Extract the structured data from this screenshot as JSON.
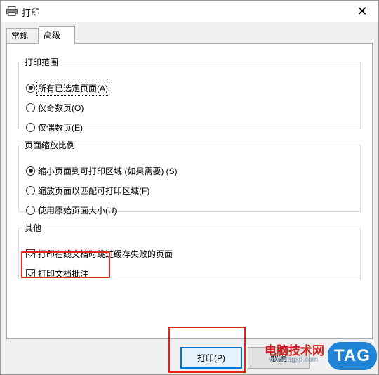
{
  "window": {
    "title": "打印",
    "close_glyph": "✕",
    "title_icon": "printer-icon"
  },
  "tabs": [
    {
      "label": "常规",
      "active": false
    },
    {
      "label": "高级",
      "active": true
    }
  ],
  "print_range": {
    "legend": "打印范围",
    "options": [
      {
        "label": "所有已选定页面(A)",
        "selected": true
      },
      {
        "label": "仅奇数页(O)",
        "selected": false
      },
      {
        "label": "仅偶数页(E)",
        "selected": false
      }
    ]
  },
  "page_scaling": {
    "legend": "页面缩放比例",
    "options": [
      {
        "label": "缩小页面到可打印区域 (如果需要) (S)",
        "selected": true
      },
      {
        "label": "缩放页面以匹配可打印区域(F)",
        "selected": false
      },
      {
        "label": "使用原始页面大小(U)",
        "selected": false
      }
    ]
  },
  "other": {
    "legend": "其他",
    "options": [
      {
        "label": "打印在线文档时跳过缓存失败的页面",
        "checked": true
      },
      {
        "label": "打印文档批注",
        "checked": true
      }
    ]
  },
  "buttons": {
    "print_label": "打印(P)",
    "cancel_label": "取消"
  },
  "watermark": {
    "site_name": "电脑技术网",
    "url": "www.tagxp.com",
    "logo_text": "TAG"
  },
  "colors": {
    "highlight_box": "#e0261b",
    "primary_border": "#0078d7",
    "watermark_logo": "#1f83d6"
  }
}
